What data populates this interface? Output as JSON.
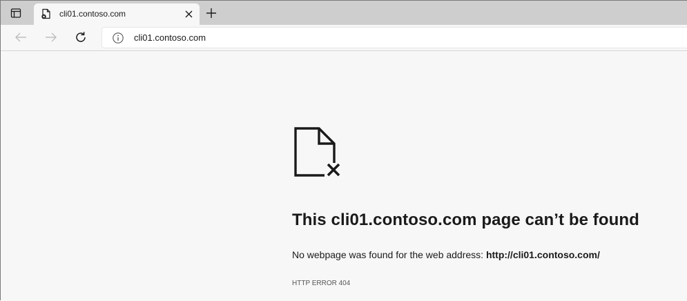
{
  "tab": {
    "title": "cli01.contoso.com"
  },
  "address_bar": {
    "value": "cli01.contoso.com"
  },
  "error": {
    "title": "This cli01.contoso.com page can’t be found",
    "description_prefix": "No webpage was found for the web address: ",
    "url": "http://cli01.contoso.com/",
    "code": "HTTP ERROR 404"
  },
  "colors": {
    "tabstrip": "#cecece",
    "page_background": "#f7f7f7",
    "text": "#1a1a1a"
  }
}
